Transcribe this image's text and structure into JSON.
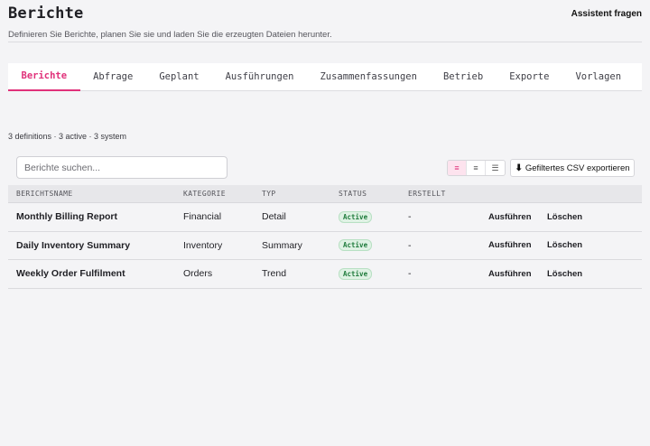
{
  "header": {
    "title": "Berichte",
    "subtitle": "Definieren Sie Berichte, planen Sie sie und laden Sie die erzeugten Dateien herunter.",
    "assistant_label": "Assistent fragen"
  },
  "tabs": [
    {
      "label": "Berichte",
      "active": true
    },
    {
      "label": "Abfrage",
      "active": false
    },
    {
      "label": "Geplant",
      "active": false
    },
    {
      "label": "Ausführungen",
      "active": false
    },
    {
      "label": "Zusammenfassungen",
      "active": false
    },
    {
      "label": "Betrieb",
      "active": false
    },
    {
      "label": "Exporte",
      "active": false
    },
    {
      "label": "Vorlagen",
      "active": false
    }
  ],
  "summary": "3 definitions · 3 active · 3 system",
  "search": {
    "placeholder": "Berichte suchen...",
    "value": ""
  },
  "view_toggle": [
    {
      "icon": "list-view-icon",
      "glyph": "≡",
      "active": true
    },
    {
      "icon": "compact-view-icon",
      "glyph": "≡",
      "active": false
    },
    {
      "icon": "dense-view-icon",
      "glyph": "☰",
      "active": false
    }
  ],
  "export": {
    "icon": "download-icon",
    "glyph": "⬇",
    "label": "Gefiltertes CSV exportieren"
  },
  "table": {
    "columns": [
      "BERICHTSNAME",
      "KATEGORIE",
      "TYP",
      "STATUS",
      "ERSTELLT"
    ],
    "rows": [
      {
        "name": "Monthly Billing Report",
        "category": "Financial",
        "type": "Detail",
        "status": "Active",
        "created": "-",
        "run": "Ausführen",
        "delete": "Löschen"
      },
      {
        "name": "Daily Inventory Summary",
        "category": "Inventory",
        "type": "Summary",
        "status": "Active",
        "created": "-",
        "run": "Ausführen",
        "delete": "Löschen"
      },
      {
        "name": "Weekly Order Fulfilment",
        "category": "Orders",
        "type": "Trend",
        "status": "Active",
        "created": "-",
        "run": "Ausführen",
        "delete": "Löschen"
      }
    ]
  },
  "colors": {
    "accent": "#e0317a",
    "status_active_bg": "#dff2e4",
    "status_active_text": "#1d7a3a"
  }
}
